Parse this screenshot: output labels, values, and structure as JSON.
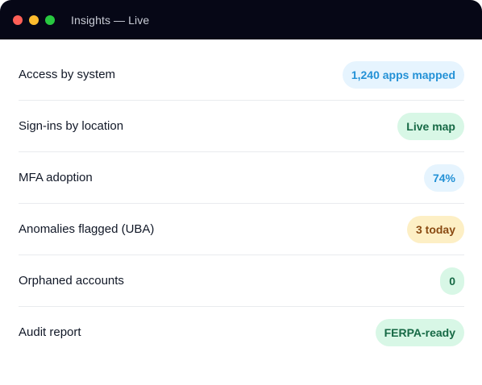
{
  "window": {
    "title": "Insights — Live"
  },
  "rows": [
    {
      "label": "Access by system",
      "badge": "1,240 apps mapped",
      "badge_color": "#2391d6",
      "badge_bg": "#e6f4fe"
    },
    {
      "label": "Sign-ins by location",
      "badge": "Live map",
      "badge_color": "#166945",
      "badge_bg": "#d8f7e6"
    },
    {
      "label": "MFA adoption",
      "badge": "74%",
      "badge_color": "#2391d6",
      "badge_bg": "#e6f4fe"
    },
    {
      "label": "Anomalies flagged (UBA)",
      "badge": "3 today",
      "badge_color": "#8a4a12",
      "badge_bg": "#fdefc5"
    },
    {
      "label": "Orphaned accounts",
      "badge": "0",
      "badge_color": "#166945",
      "badge_bg": "#d8f7e6"
    },
    {
      "label": "Audit report",
      "badge": "FERPA-ready",
      "badge_color": "#166945",
      "badge_bg": "#d8f7e6"
    }
  ]
}
